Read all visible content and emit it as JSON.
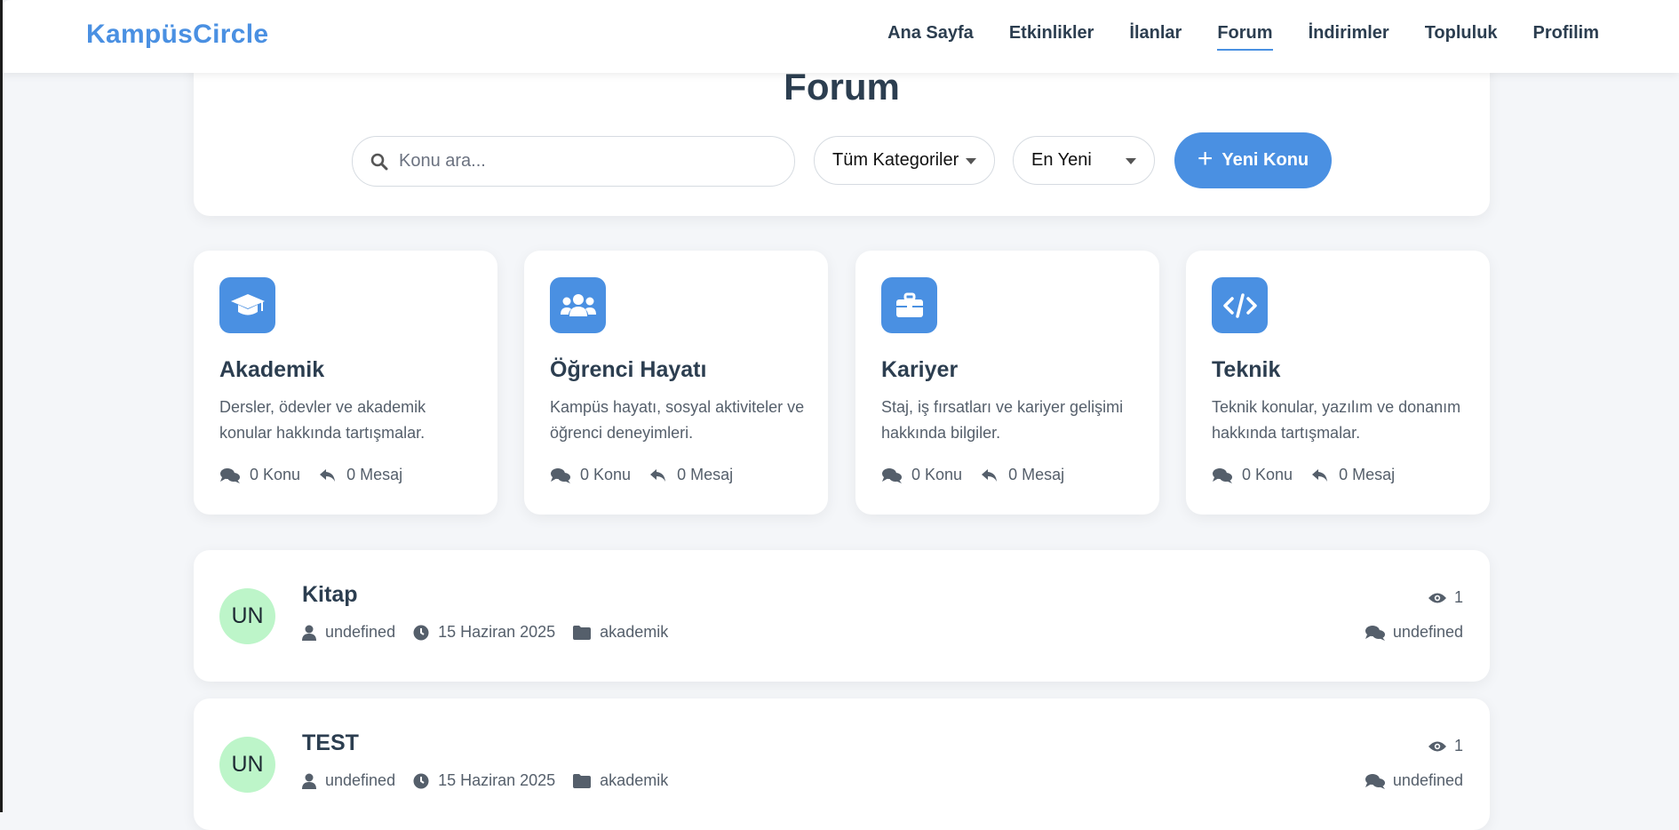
{
  "brand": "KampüsCircle",
  "nav": [
    {
      "label": "Ana Sayfa"
    },
    {
      "label": "Etkinlikler"
    },
    {
      "label": "İlanlar"
    },
    {
      "label": "Forum",
      "active": true
    },
    {
      "label": "İndirimler"
    },
    {
      "label": "Topluluk"
    },
    {
      "label": "Profilim"
    }
  ],
  "header": {
    "title": "Forum",
    "search_placeholder": "Konu ara...",
    "category_select": "Tüm Kategoriler",
    "sort_select": "En Yeni",
    "new_topic_label": "Yeni Konu"
  },
  "categories": [
    {
      "icon": "graduation-cap-icon",
      "title": "Akademik",
      "description": "Dersler, ödevler ve akademik konular hakkında tartışmalar.",
      "topics": "0 Konu",
      "messages": "0 Mesaj"
    },
    {
      "icon": "users-icon",
      "title": "Öğrenci Hayatı",
      "description": "Kampüs hayatı, sosyal aktiviteler ve öğrenci deneyimleri.",
      "topics": "0 Konu",
      "messages": "0 Mesaj"
    },
    {
      "icon": "briefcase-icon",
      "title": "Kariyer",
      "description": "Staj, iş fırsatları ve kariyer gelişimi hakkında bilgiler.",
      "topics": "0 Konu",
      "messages": "0 Mesaj"
    },
    {
      "icon": "code-icon",
      "title": "Teknik",
      "description": "Teknik konular, yazılım ve donanım hakkında tartışmalar.",
      "topics": "0 Konu",
      "messages": "0 Mesaj"
    }
  ],
  "topics": [
    {
      "avatar": "UN",
      "title": "Kitap",
      "author": "undefined",
      "date": "15 Haziran 2025",
      "category": "akademik",
      "views": "1",
      "replies": "undefined"
    },
    {
      "avatar": "UN",
      "title": "TEST",
      "author": "undefined",
      "date": "15 Haziran 2025",
      "category": "akademik",
      "views": "1",
      "replies": "undefined"
    }
  ],
  "colors": {
    "accent": "#4a90e2",
    "avatar_bg": "#bdf5c9",
    "text": "#2c3e50"
  }
}
